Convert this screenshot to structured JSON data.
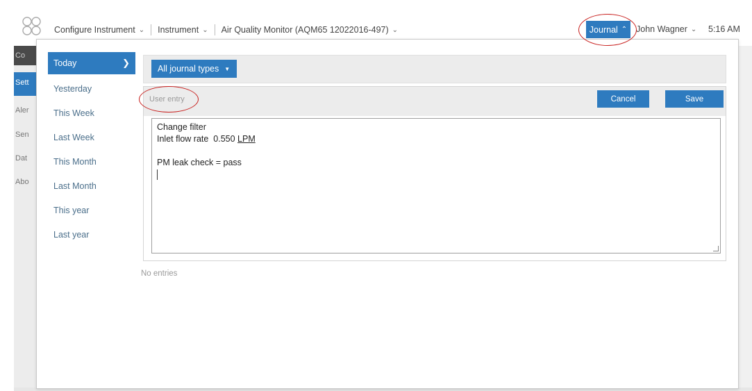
{
  "header": {
    "breadcrumbs": [
      {
        "label": "Configure Instrument"
      },
      {
        "label": "Instrument"
      },
      {
        "label": "Air Quality Monitor (AQM65 12022016-497)"
      }
    ],
    "journal_label": "Journal",
    "user_name": "John Wagner",
    "time": "5:16 AM"
  },
  "background": {
    "nav_fragments": [
      "Co",
      "Sett",
      "Aler",
      "Sen",
      "Dat",
      "Abo"
    ]
  },
  "sidebar": {
    "items": [
      {
        "label": "Today",
        "active": true
      },
      {
        "label": "Yesterday"
      },
      {
        "label": "This Week"
      },
      {
        "label": "Last Week"
      },
      {
        "label": "This Month"
      },
      {
        "label": "Last Month"
      },
      {
        "label": "This year"
      },
      {
        "label": "Last year"
      }
    ]
  },
  "filter": {
    "journal_types_label": "All journal types"
  },
  "entry": {
    "label": "User entry",
    "cancel_label": "Cancel",
    "save_label": "Save",
    "lines": [
      {
        "prefix": "Change filter",
        "underlined": ""
      },
      {
        "prefix": "Inlet flow rate  0.550 ",
        "underlined": "LPM"
      },
      {
        "prefix": "",
        "underlined": ""
      },
      {
        "prefix": "PM leak check = pass",
        "underlined": ""
      }
    ]
  },
  "empty_state": "No entries",
  "colors": {
    "accent": "#2e7bbf",
    "annotation": "#c8201e"
  }
}
